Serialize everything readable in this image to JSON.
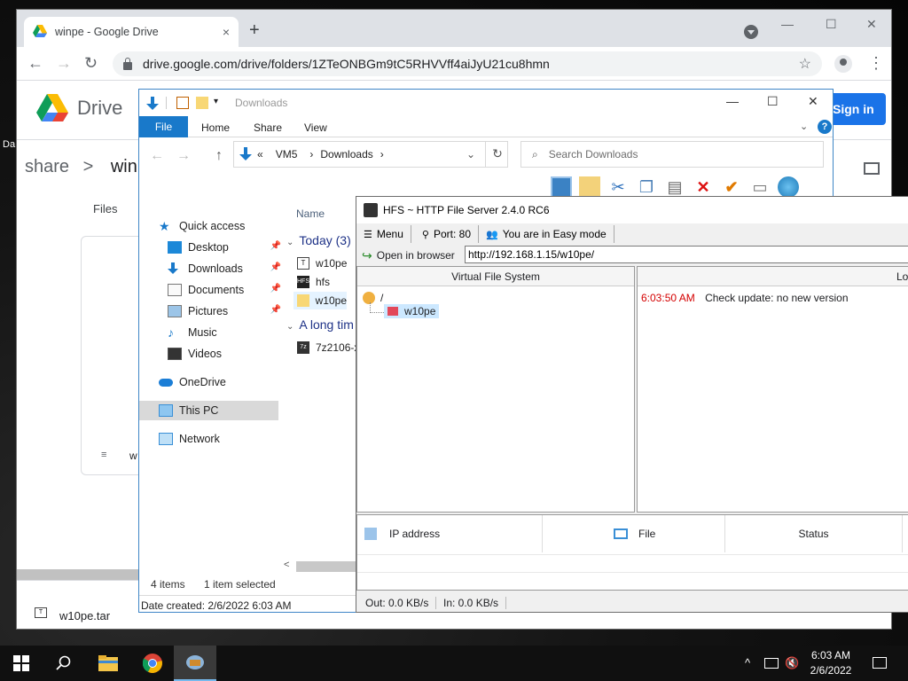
{
  "desktop": {
    "fragment": "Da"
  },
  "chrome": {
    "tab_title": "winpe - Google Drive",
    "tab_close": "×",
    "new_tab": "+",
    "controls": {
      "minimize": "—",
      "maximize": "☐",
      "close": "✕"
    },
    "back": "←",
    "forward": "→",
    "reload": "↻",
    "url": "drive.google.com/drive/folders/1ZTeONBGm9tC5RHVVff4aiJyU21cu8hmn",
    "bookmark": "☆",
    "menu": "⋮"
  },
  "drive": {
    "brand": "Drive",
    "sign_in": "Sign in",
    "breadcrumb_first": "share",
    "breadcrumb_sep": ">",
    "breadcrumb_second": "winp",
    "files_label": "Files",
    "card_item_initial": "w",
    "download_file": "w10pe.tar",
    "colors": {
      "accent": "#1a73e8"
    }
  },
  "explorer": {
    "title": "Downloads",
    "controls": {
      "minimize": "—",
      "maximize": "☐",
      "close": "✕"
    },
    "ribbon_tabs": {
      "file": "File",
      "home": "Home",
      "share": "Share",
      "view": "View",
      "help": "?"
    },
    "ribbon_chevron": "⌄",
    "back": "←",
    "forward": "→",
    "up": "↑",
    "path_prefix": "«",
    "path": [
      "VM5",
      "Downloads"
    ],
    "path_sep": "›",
    "path_dropdown": "⌄",
    "refresh": "↻",
    "search_placeholder": "Search Downloads",
    "nav": {
      "quick_access": "Quick access",
      "desktop": "Desktop",
      "downloads": "Downloads",
      "documents": "Documents",
      "pictures": "Pictures",
      "music": "Music",
      "videos": "Videos",
      "onedrive": "OneDrive",
      "this_pc": "This PC",
      "network": "Network"
    },
    "column_name": "Name",
    "group_today": "Today (3)",
    "group_long": "A long tim",
    "files": {
      "f1": "w10pe",
      "f2": "hfs",
      "f3": "w10pe",
      "f4": "7z2106-x"
    },
    "status_items": "4 items",
    "status_selected": "1 item selected",
    "details": "Date created: 2/6/2022 6:03 AM",
    "scroll_left": "<"
  },
  "hfs": {
    "title": "HFS ~ HTTP File Server 2.4.0 RC6",
    "menu": "Menu",
    "port": "Port: 80",
    "mode": "You are in Easy mode",
    "open_in_browser": "Open in browser",
    "url": "http://192.168.1.15/w10pe/",
    "vfs_header": "Virtual File System",
    "vfs_root": "/",
    "vfs_item": "w10pe",
    "log_header": "Log",
    "log_time": "6:03:50 AM",
    "log_message": "Check update: no new version",
    "col_ip": "IP address",
    "col_file": "File",
    "col_status": "Status",
    "out_speed": "Out: 0.0 KB/s",
    "in_speed": "In: 0.0 KB/s",
    "colors": {
      "log_time": "#d40000"
    }
  },
  "taskbar": {
    "time": "6:03 AM",
    "date": "2/6/2022",
    "tray_chevron": "^"
  }
}
